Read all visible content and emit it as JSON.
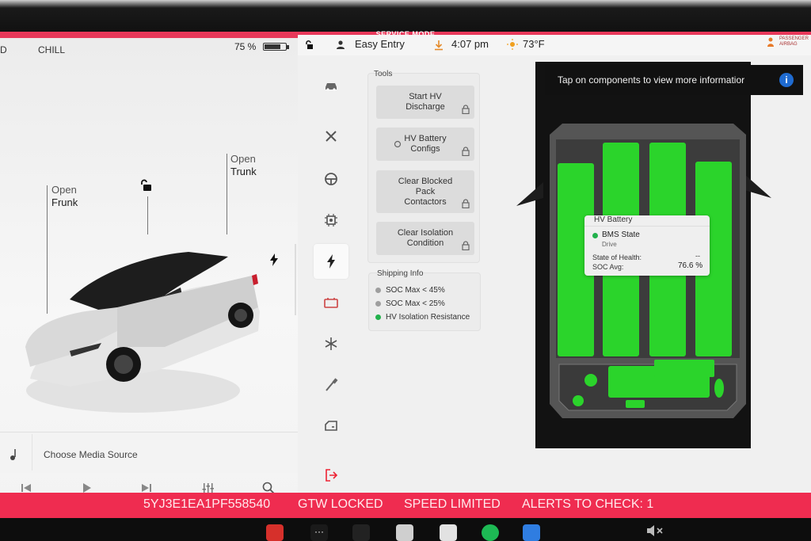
{
  "service_mode": {
    "label": "SERVICE MODE"
  },
  "status": {
    "gear": "D",
    "drive_mode": "CHILL",
    "battery_percent": "75 %"
  },
  "topbar": {
    "profile": "Easy Entry",
    "time": "4:07 pm",
    "temperature": "73°F",
    "airbag_label": "PASSENGER AIRBAG"
  },
  "car_view": {
    "frunk_line1": "Open",
    "frunk_line2": "Frunk",
    "trunk_line1": "Open",
    "trunk_line2": "Trunk"
  },
  "media": {
    "source_label": "Choose Media Source"
  },
  "nav": {
    "items": [
      "car-icon",
      "tools-icon",
      "steering-wheel-icon",
      "chip-icon",
      "bolt-icon",
      "battery-icon",
      "snowflake-icon",
      "probe-icon",
      "door-icon",
      "exit-icon"
    ],
    "active": "bolt-icon"
  },
  "tools": {
    "title": "Tools",
    "buttons": [
      {
        "label_1": "Start HV",
        "label_2": "Discharge",
        "label_3": ""
      },
      {
        "label_1": "HV Battery",
        "label_2": "Configs",
        "label_3": ""
      },
      {
        "label_1": "Clear Blocked",
        "label_2": "Pack",
        "label_3": "Contactors"
      },
      {
        "label_1": "Clear Isolation",
        "label_2": "Condition",
        "label_3": ""
      }
    ]
  },
  "shipping": {
    "title": "Shipping Info",
    "rows": [
      {
        "label": "SOC Max < 45%",
        "status_color": "#9e9e9e"
      },
      {
        "label": "SOC Max < 25%",
        "status_color": "#9e9e9e"
      },
      {
        "label": "HV Isolation Resistance",
        "status_color": "#22b14c"
      }
    ]
  },
  "battery_view": {
    "banner": "Tap on components to view more informatior",
    "popup": {
      "title": "HV Battery",
      "state_label": "BMS State",
      "state_value": "Drive",
      "soh_label": "State of Health:",
      "soh_value": "--",
      "soc_label": "SOC Avg:",
      "soc_value": "76.6 %"
    },
    "module_color": "#2bd42b"
  },
  "alerts": {
    "vin": "5YJ3E1EA1PF558540",
    "gtw": "GTW LOCKED",
    "speed": "SPEED LIMITED",
    "alerts_to_check": "ALERTS TO CHECK: 1"
  }
}
